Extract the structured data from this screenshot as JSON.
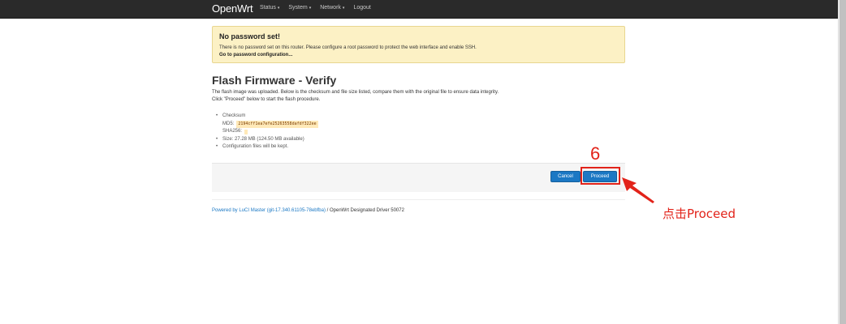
{
  "nav": {
    "brand": "OpenWrt",
    "menu": [
      {
        "label": "Status",
        "caret": "▾"
      },
      {
        "label": "System",
        "caret": "▾"
      },
      {
        "label": "Network",
        "caret": "▾"
      },
      {
        "label": "Logout",
        "caret": ""
      }
    ]
  },
  "alert": {
    "title": "No password set!",
    "text": "There is no password set on this router. Please configure a root password to protect the web interface and enable SSH.",
    "link": "Go to password configuration..."
  },
  "page": {
    "title": "Flash Firmware - Verify",
    "desc_line1": "The flash image was uploaded. Below is the checksum and file size listed, compare them with the original file to ensure data integrity.",
    "desc_line2": "Click \"Proceed\" below to start the flash procedure."
  },
  "details": {
    "checksum_label": "Checksum",
    "md5_label": "MD5:",
    "md5_value": "2194cff1ea7efe25263558dafdf322ee",
    "sha256_label": "SHA256:",
    "size": "Size: 27.28 MB (124.50 MB available)",
    "config": "Configuration files will be kept."
  },
  "actions": {
    "cancel_label": "Cancel",
    "proceed_label": "Proceed"
  },
  "footer": {
    "powered_link": "Powered by LuCI Master (git-17.340.61105-78ebfba)",
    "rest": " / OpenWrt Designated Driver 50072"
  },
  "annotation": {
    "step": "6",
    "text": "点击Proceed",
    "color": "#e2231a"
  },
  "colors": {
    "topbar": "#2a2a2a",
    "alert_bg": "#fcf1c5",
    "button": "#1b78c4"
  }
}
